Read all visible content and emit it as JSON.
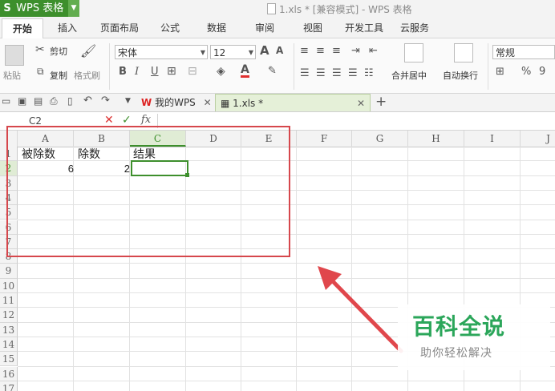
{
  "app": {
    "name": "WPS 表格",
    "logo": "S",
    "window_title": "1.xls * [兼容模式] - WPS 表格"
  },
  "ribbon_tabs": [
    "开始",
    "插入",
    "页面布局",
    "公式",
    "数据",
    "审阅",
    "视图",
    "开发工具",
    "云服务"
  ],
  "ribbon": {
    "cut": "剪切",
    "paste": "粘贴",
    "copy": "复制",
    "format_painter": "格式刷",
    "font_name": "宋体",
    "font_size": "12",
    "merge_center": "合并居中",
    "wrap_text": "自动换行",
    "number_format": "常规",
    "bold": "B",
    "italic": "I",
    "underline": "U",
    "grow": "A",
    "shrink": "A",
    "percent": "%",
    "comma": "9"
  },
  "doc_tabs": {
    "home": "我的WPS",
    "file": "1.xls *"
  },
  "formula_bar": {
    "name_box": "C2",
    "fx": "fx",
    "content": ""
  },
  "columns": [
    "A",
    "B",
    "C",
    "D",
    "E",
    "F",
    "G",
    "H",
    "I",
    "J"
  ],
  "rows": [
    "1",
    "2",
    "3",
    "4",
    "5",
    "6",
    "7",
    "8",
    "9",
    "10",
    "11",
    "12",
    "13",
    "14",
    "15",
    "16",
    "17"
  ],
  "cells": {
    "A1": "被除数",
    "B1": "除数",
    "C1": "结果",
    "A2": "6",
    "B2": "2"
  },
  "selected_cell": "C2",
  "colors": {
    "accent": "#3d8f2c",
    "highlight": "#d6474c",
    "watermark": "#2ba65a"
  },
  "watermark": {
    "title": "百科全说",
    "subtitle": "助你轻松解决"
  }
}
